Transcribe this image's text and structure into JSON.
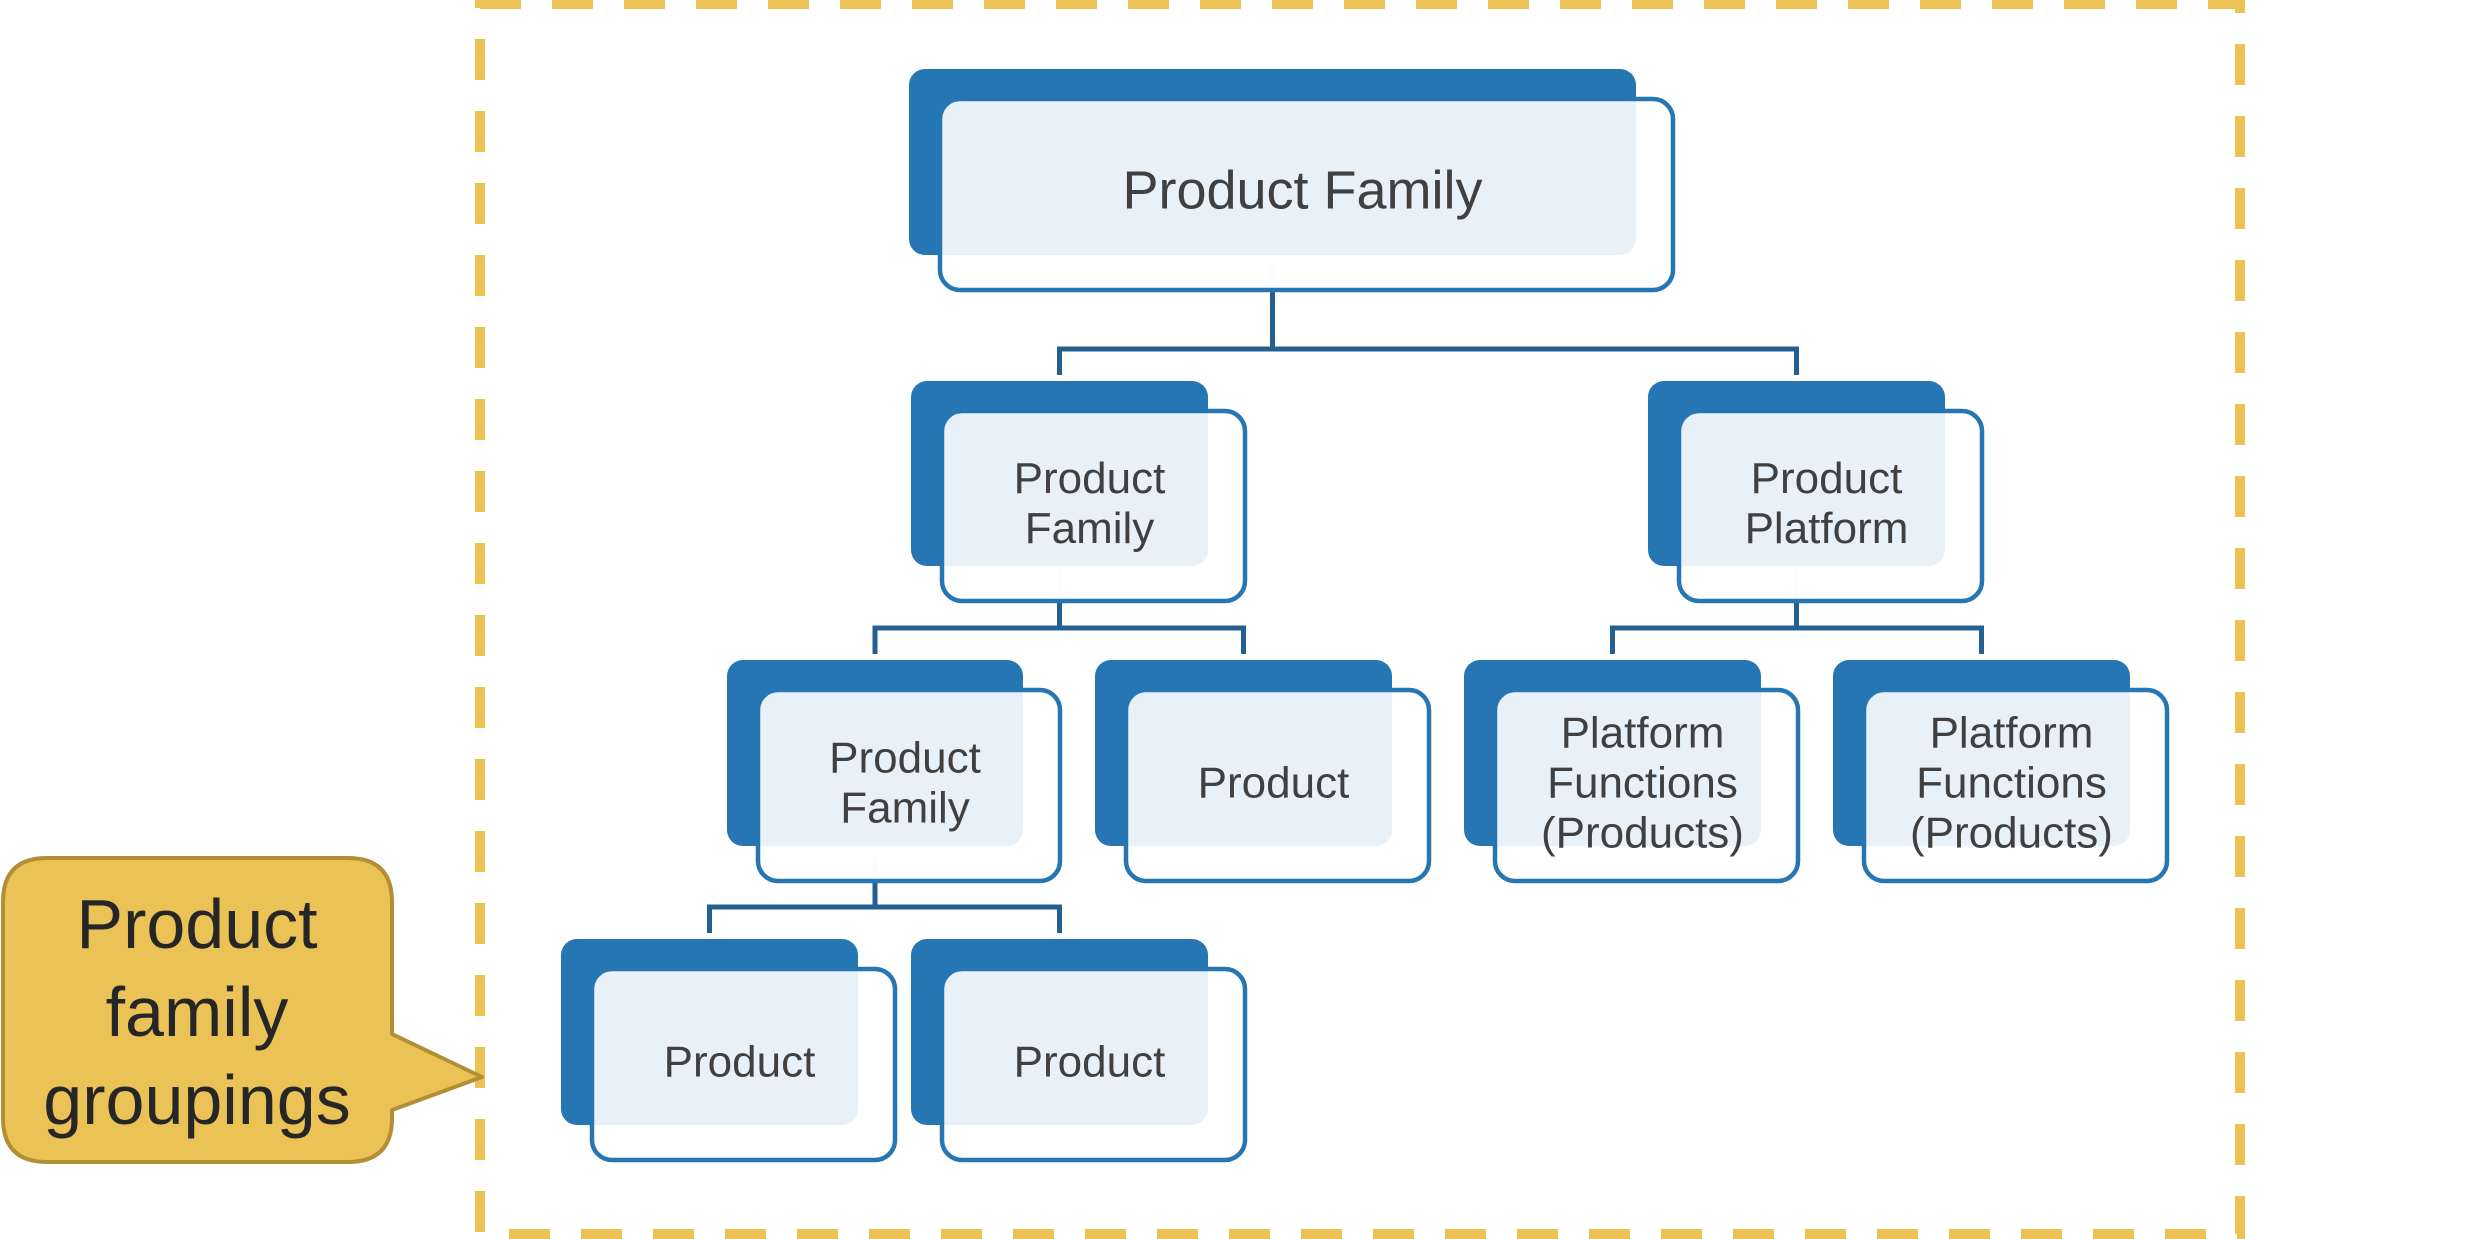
{
  "diagram": {
    "type": "hierarchy",
    "colors": {
      "node_back": "#2776B4",
      "node_outline": "#2776B4",
      "node_front_fill": "#E9F0F7",
      "connector": "#235F91",
      "text": "#404040",
      "group_border": "#EDC255",
      "callout_fill": "#EBC255",
      "callout_stroke": "#B28F34",
      "callout_text": "#262626"
    },
    "nodes": [
      {
        "id": "root",
        "label": [
          "Product Family"
        ],
        "parent": null
      },
      {
        "id": "pf-1",
        "label": [
          "Product",
          "Family"
        ],
        "parent": "root"
      },
      {
        "id": "pp-1",
        "label": [
          "Product",
          "Platform"
        ],
        "parent": "root"
      },
      {
        "id": "pf-2",
        "label": [
          "Product",
          "Family"
        ],
        "parent": "pf-1"
      },
      {
        "id": "p-1",
        "label": [
          "Product"
        ],
        "parent": "pf-1"
      },
      {
        "id": "fn-1",
        "label": [
          "Platform",
          "Functions",
          "(Products)"
        ],
        "parent": "pp-1"
      },
      {
        "id": "fn-2",
        "label": [
          "Platform",
          "Functions",
          "(Products)"
        ],
        "parent": "pp-1"
      },
      {
        "id": "p-2",
        "label": [
          "Product"
        ],
        "parent": "pf-2"
      },
      {
        "id": "p-3",
        "label": [
          "Product"
        ],
        "parent": "pf-2"
      }
    ],
    "callout": {
      "label": [
        "Product",
        "family",
        "groupings"
      ]
    }
  }
}
